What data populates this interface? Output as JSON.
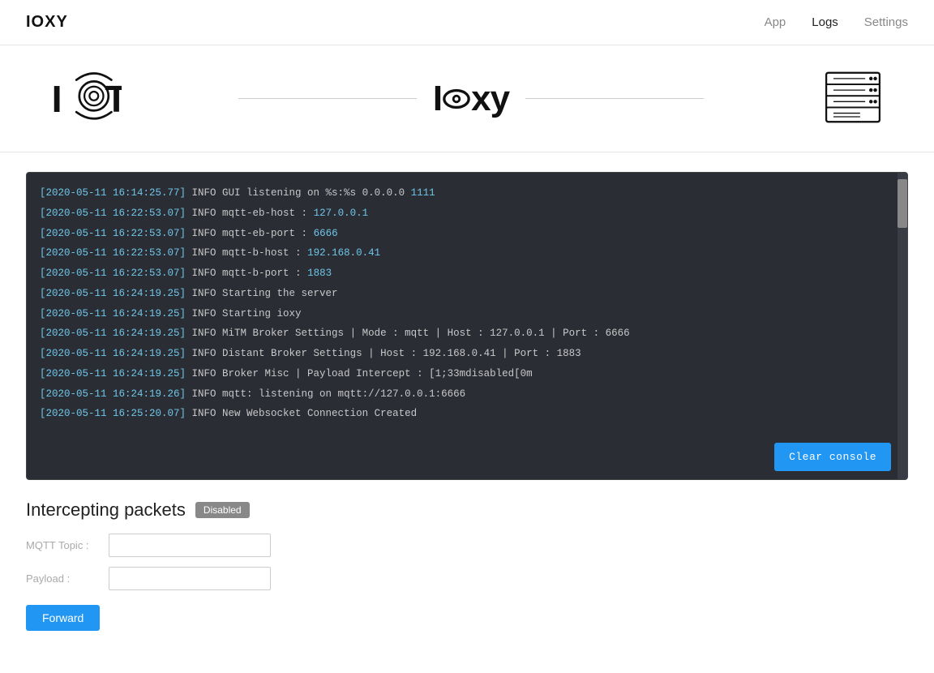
{
  "navbar": {
    "brand": "IOXY",
    "links": [
      {
        "label": "App",
        "active": false
      },
      {
        "label": "Logs",
        "active": true
      },
      {
        "label": "Settings",
        "active": false
      }
    ]
  },
  "banner": {
    "wordmark": "ioxy",
    "left_line": true,
    "right_line": true
  },
  "console": {
    "lines": [
      {
        "text": "[2020-05-11 16:14:25.77] INFO GUI listening on %s:%s 0.0.0.0 1111",
        "highlight_end": "1111"
      },
      {
        "text": "[2020-05-11 16:22:53.07] INFO mqtt-eb-host : 127.0.0.1",
        "highlight_end": "127.0.0.1"
      },
      {
        "text": "[2020-05-11 16:22:53.07] INFO mqtt-eb-port : 6666",
        "highlight_end": "6666"
      },
      {
        "text": "[2020-05-11 16:22:53.07] INFO mqtt-b-host : 192.168.0.41",
        "highlight_end": "192.168.0.41"
      },
      {
        "text": "[2020-05-11 16:22:53.07] INFO mqtt-b-port : 1883",
        "highlight_end": "1883"
      },
      {
        "text": "[2020-05-11 16:24:19.25] INFO Starting the server",
        "highlight_end": ""
      },
      {
        "text": "[2020-05-11 16:24:19.25] INFO Starting ioxy",
        "highlight_end": ""
      },
      {
        "text": "[2020-05-11 16:24:19.25] INFO MiTM Broker Settings | Mode : mqtt | Host : 127.0.0.1 | Port : 6666",
        "highlight_end": ""
      },
      {
        "text": "[2020-05-11 16:24:19.25] INFO Distant Broker Settings | Host : 192.168.0.41 | Port : 1883",
        "highlight_end": ""
      },
      {
        "text": "[2020-05-11 16:24:19.25] INFO Broker Misc | Payload Intercept : [1;33mdisabled[0m",
        "highlight_end": ""
      },
      {
        "text": "[2020-05-11 16:24:19.26] INFO mqtt: listening on mqtt://127.0.0.1:6666",
        "highlight_end": ""
      },
      {
        "text": "[2020-05-11 16:25:20.07] INFO New Websocket Connection Created",
        "highlight_end": ""
      }
    ],
    "clear_button_label": "Clear console"
  },
  "intercepting": {
    "title": "Intercepting packets",
    "badge_label": "Disabled",
    "mqtt_topic_label": "MQTT Topic :",
    "mqtt_topic_placeholder": "",
    "payload_label": "Payload :",
    "payload_placeholder": "",
    "forward_button_label": "Forward"
  }
}
